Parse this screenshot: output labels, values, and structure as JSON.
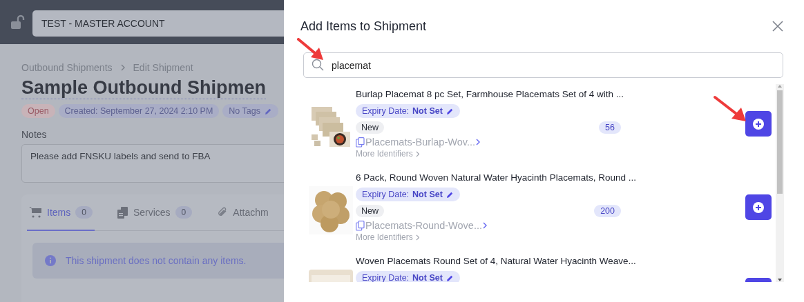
{
  "top_bar": {
    "account": "TEST - MASTER ACCOUNT"
  },
  "breadcrumb": [
    "Outbound Shipments",
    "Edit Shipment"
  ],
  "title": "Sample Outbound Shipmen",
  "badges": [
    {
      "text": "Open",
      "kind": "status"
    },
    {
      "text": "Created: September 27, 2024 2:10 PM",
      "kind": "info"
    },
    {
      "text": "No Tags",
      "kind": "tags"
    }
  ],
  "notes": {
    "label": "Notes",
    "value": "Please add FNSKU labels and send to FBA"
  },
  "tabs": [
    {
      "label": "Items",
      "count": "0",
      "selected": true
    },
    {
      "label": "Services",
      "count": "0",
      "selected": false
    },
    {
      "label": "Attachm",
      "selected": false
    }
  ],
  "alert": "This shipment does not contain any items.",
  "modal": {
    "title": "Add Items to Shipment",
    "search": {
      "value": "placemat"
    },
    "items": [
      {
        "title": "Burlap Placemat 8 pc Set, Farmhouse Placemats Set of 4 with ...",
        "expiry_label": "Expiry Date:",
        "expiry_value": "Not Set",
        "condition": "New",
        "count": "56",
        "sku": "Placemats-Burlap-Wov...",
        "more": "More Identifiers"
      },
      {
        "title": "6 Pack, Round Woven Natural Water Hyacinth Placemats, Round ...",
        "expiry_label": "Expiry Date:",
        "expiry_value": "Not Set",
        "condition": "New",
        "count": "200",
        "sku": "Placemats-Round-Wove...",
        "more": "More Identifiers"
      },
      {
        "title": "Woven Placemats Round Set of 4, Natural Water Hyacinth Weave...",
        "expiry_label": "Expiry Date:",
        "expiry_value": "Not Set"
      }
    ]
  }
}
